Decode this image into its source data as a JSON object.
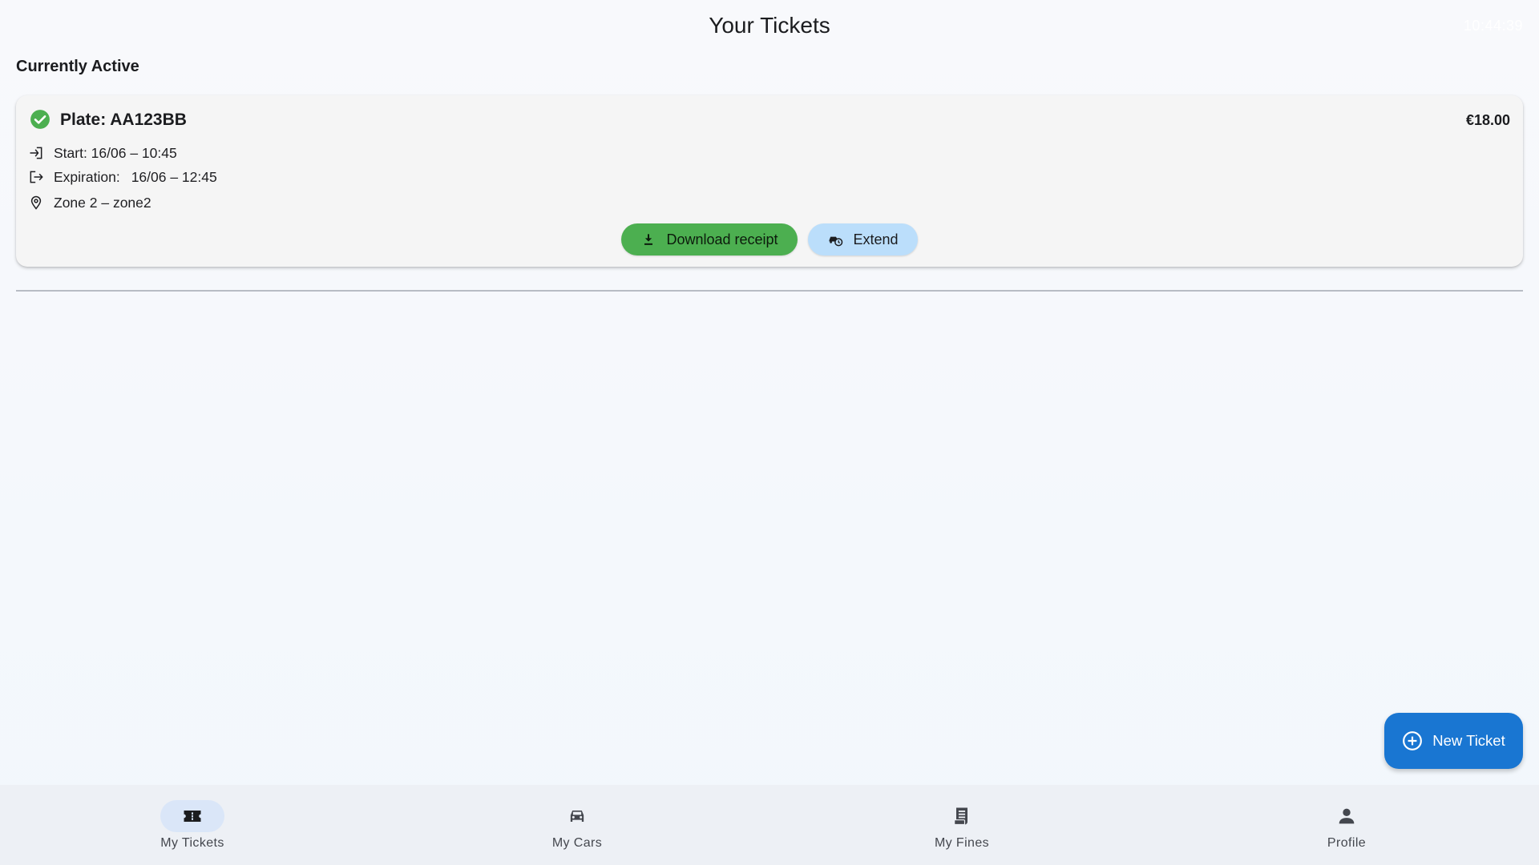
{
  "header": {
    "title": "Your Tickets",
    "clock": "10:44:39"
  },
  "section": {
    "active_title": "Currently Active"
  },
  "ticket": {
    "status_icon": "check-circle-icon",
    "plate_label": "Plate: AA123BB",
    "price": "€18.00",
    "start_label": "Start: 16/06 – 10:45",
    "expiration_label": "Expiration:",
    "expiration_value": "16/06 – 12:45",
    "zone_label": "Zone 2 – zone2",
    "download_label": "Download receipt",
    "extend_label": "Extend"
  },
  "fab": {
    "label": "New Ticket",
    "icon": "add-circle-icon"
  },
  "nav": {
    "items": [
      {
        "label": "My Tickets",
        "icon": "ticket-icon",
        "active": true
      },
      {
        "label": "My Cars",
        "icon": "car-icon",
        "active": false
      },
      {
        "label": "My Fines",
        "icon": "receipt-icon",
        "active": false
      },
      {
        "label": "Profile",
        "icon": "person-icon",
        "active": false
      }
    ]
  },
  "colors": {
    "success": "#4caf50",
    "extend_bg": "#bbdefb",
    "primary": "#1976d2",
    "nav_active_pill": "#dae6f8"
  }
}
